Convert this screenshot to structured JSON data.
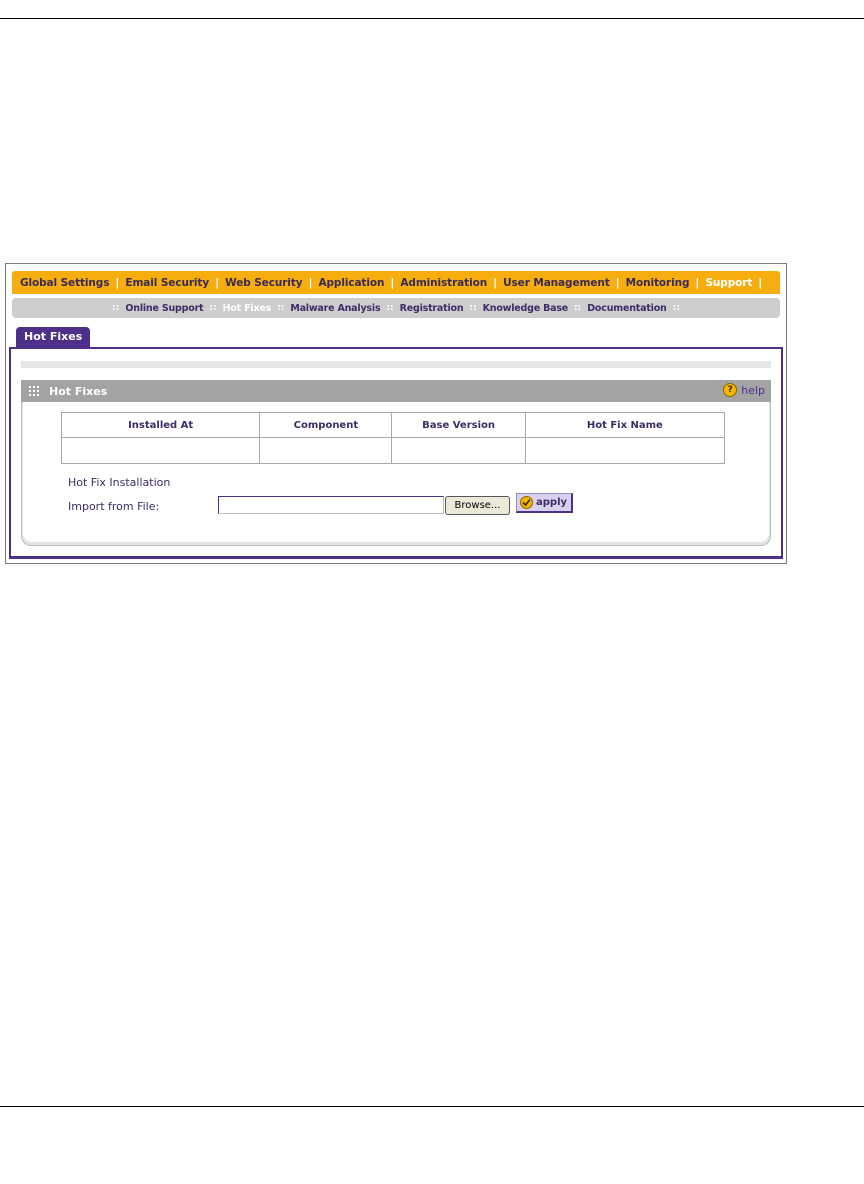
{
  "nav": {
    "main": [
      {
        "label": "Global Settings",
        "active": false
      },
      {
        "label": "Email Security",
        "active": false
      },
      {
        "label": "Web Security",
        "active": false
      },
      {
        "label": "Application",
        "active": false
      },
      {
        "label": "Administration",
        "active": false
      },
      {
        "label": "User Management",
        "active": false
      },
      {
        "label": "Monitoring",
        "active": false
      },
      {
        "label": "Support",
        "active": true
      }
    ],
    "separator": "|",
    "sub": [
      {
        "label": "Online Support",
        "active": false
      },
      {
        "label": "Hot Fixes",
        "active": true
      },
      {
        "label": "Malware Analysis",
        "active": false
      },
      {
        "label": "Registration",
        "active": false
      },
      {
        "label": "Knowledge Base",
        "active": false
      },
      {
        "label": "Documentation",
        "active": false
      }
    ],
    "sub_separator": "::"
  },
  "tab": {
    "label": "Hot Fixes"
  },
  "section": {
    "title": "Hot Fixes",
    "help_label": "help",
    "help_icon": "?"
  },
  "table": {
    "columns": [
      "Installed At",
      "Component",
      "Base Version",
      "Hot Fix Name"
    ],
    "rows": [
      [
        "",
        "",
        "",
        ""
      ]
    ]
  },
  "installation": {
    "title": "Hot Fix Installation",
    "import_label": "Import from File:",
    "file_value": "",
    "browse_label": "Browse...",
    "apply_label": "apply"
  },
  "colors": {
    "nav_orange": "#f5ad0f",
    "brand_purple": "#4e2f8a",
    "header_gray": "#a3a3a3"
  }
}
